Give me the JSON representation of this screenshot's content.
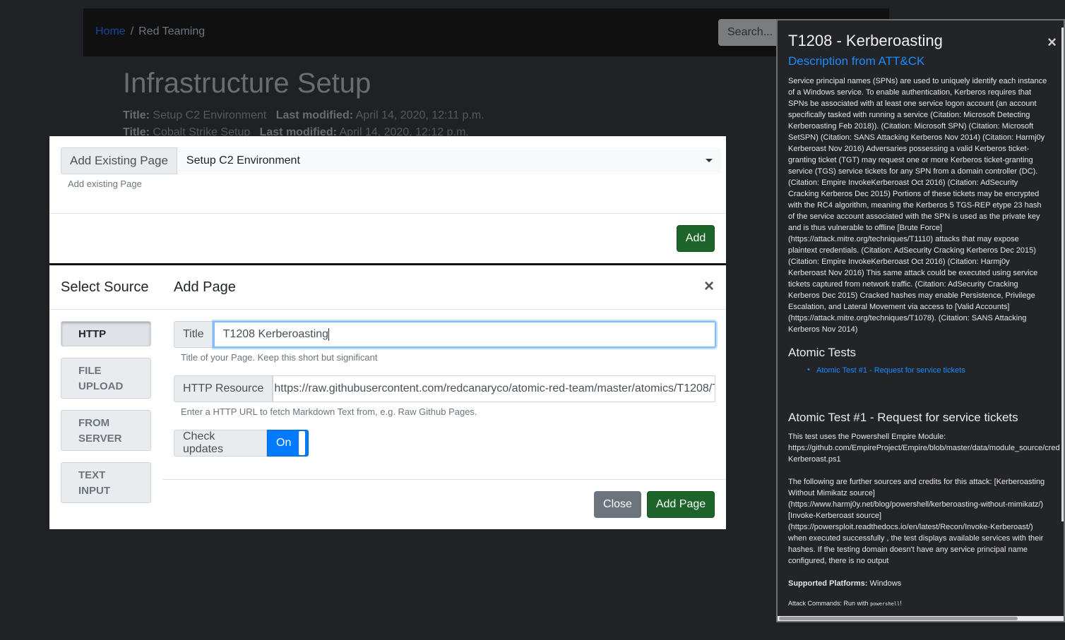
{
  "background": {
    "breadcrumb": {
      "home": "Home",
      "separator": "/",
      "current": "Red Teaming"
    },
    "search_placeholder": "Search...",
    "page_title": "Infrastructure Setup",
    "entries": [
      {
        "title_label": "Title:",
        "title": "Setup C2 Environment",
        "modified_label": "Last modified:",
        "modified": "April 14, 2020, 12:11 p.m."
      },
      {
        "title_label": "Title:",
        "title": "Cobalt Strike Setup",
        "modified_label": "Last modified:",
        "modified": "April 14, 2020, 12:12 p.m."
      }
    ]
  },
  "existing_modal": {
    "addon_label": "Add Existing Page",
    "selected_value": "Setup C2 Environment",
    "help": "Add existing Page",
    "add_button": "Add"
  },
  "add_modal": {
    "source_title": "Select Source",
    "title": "Add Page",
    "close_symbol": "×",
    "sources": [
      {
        "line1": "HTTP",
        "line2": ""
      },
      {
        "line1": "FILE",
        "line2": "UPLOAD"
      },
      {
        "line1": "FROM",
        "line2": "SERVER"
      },
      {
        "line1": "TEXT",
        "line2": "INPUT"
      }
    ],
    "title_label": "Title",
    "title_value": "T1208 Kerberoasting",
    "title_help": "Title of your Page. Keep this short but significant",
    "resource_label": "HTTP Resource",
    "resource_value": "https://raw.githubusercontent.com/redcanaryco/atomic-red-team/master/atomics/T1208/T",
    "resource_help": "Enter a HTTP URL to fetch Markdown Text from, e.g. Raw Github Pages.",
    "check_label": "Check updates",
    "toggle_value": "On",
    "close_button": "Close",
    "add_button": "Add Page"
  },
  "panel": {
    "title": "T1208 - Kerberoasting",
    "close_symbol": "×",
    "subtitle": "Description from ATT&CK",
    "description_lines": [
      "Service principal names (SPNs) are used to uniquely identify each instance",
      "of a Windows service. To enable authentication, Kerberos requires that",
      "SPNs be associated with at least one service logon account (an account",
      "specifically tasked with running a service (Citation: Microsoft Detecting",
      "Kerberoasting Feb 2018)). (Citation: Microsoft SPN) (Citation: Microsoft",
      "SetSPN) (Citation: SANS Attacking Kerberos Nov 2014) (Citation: Harmj0y",
      "Kerberoast Nov 2016) Adversaries possessing a valid Kerberos ticket-",
      "granting ticket (TGT) may request one or more Kerberos ticket-granting",
      "service (TGS) service tickets for any SPN from a domain controller (DC).",
      "(Citation: Empire InvokeKerberoast Oct 2016) (Citation: AdSecurity",
      "Cracking Kerberos Dec 2015) Portions of these tickets may be encrypted",
      "with the RC4 algorithm, meaning the Kerberos 5 TGS-REP etype 23 hash",
      "of the service account associated with the SPN is used as the private key",
      "and is thus vulnerable to offline [Brute Force]",
      "(https://attack.mitre.org/techniques/T1110) attacks that may expose",
      "plaintext credentials. (Citation: AdSecurity Cracking Kerberos Dec 2015)",
      "(Citation: Empire InvokeKerberoast Oct 2016) (Citation: Harmj0y",
      "Kerberoast Nov 2016) This same attack could be executed using service",
      "tickets captured from network traffic. (Citation: AdSecurity Cracking",
      "Kerberos Dec 2015) Cracked hashes may enable Persistence, Privilege",
      "Escalation, and Lateral Movement via access to [Valid Accounts]",
      "(https://attack.mitre.org/techniques/T1078). (Citation: SANS Attacking",
      "Kerberos Nov 2014)"
    ],
    "atomic_tests_heading": "Atomic Tests",
    "atomic_test_link": "Atomic Test #1 - Request for service tickets",
    "test_heading": "Atomic Test #1 - Request for service tickets",
    "test_lines_1": [
      "This test uses the Powershell Empire Module:",
      "https://github.com/EmpireProject/Empire/blob/master/data/module_source/cred",
      "Kerberoast.ps1"
    ],
    "test_lines_2": [
      "The following are further sources and credits for this attack: [Kerberoasting",
      "Without Mimikatz source]",
      "(https://www.harmj0y.net/blog/powershell/kerberoasting-without-mimikatz/)",
      "[Invoke-Kerberoast source]",
      "(https://powersploit.readthedocs.io/en/latest/Recon/Invoke-Kerberoast/)",
      "when executed successfully , the test displays available services with their",
      "hashes. If the testing domain doesn't have any service principal name",
      "configured, there is no output"
    ],
    "platforms_label": "Supported Platforms:",
    "platforms_value": "Windows",
    "commands_prefix": "Attack Commands: Run with",
    "commands_code": "powershell",
    "commands_suffix": "!"
  }
}
